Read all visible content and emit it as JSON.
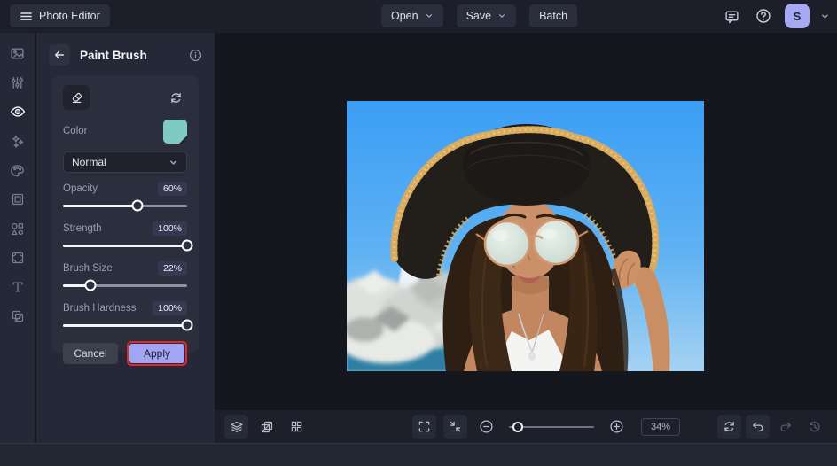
{
  "topbar": {
    "app_title": "Photo Editor",
    "open_label": "Open",
    "save_label": "Save",
    "batch_label": "Batch",
    "avatar_initial": "S",
    "avatar_color": "#a6a8f2",
    "icons": [
      "menu-icon",
      "chat-icon",
      "help-icon",
      "chevron-down-icon"
    ]
  },
  "sidebar": {
    "active_item": "eye-tool",
    "items": [
      "image-manager-icon",
      "adjustments-icon",
      "eye-icon",
      "effects-icon",
      "artsy-icon",
      "frame-icon",
      "graphics-icon",
      "ornate-frame-icon",
      "text-icon",
      "overlays-icon"
    ]
  },
  "panel": {
    "title": "Paint Brush",
    "header_icons": [
      "back-arrow-icon",
      "info-icon"
    ],
    "tool_icons": [
      "eraser-icon",
      "reset-icon"
    ],
    "color_label": "Color",
    "color_value": "#7fcbc3",
    "blend_mode": "Normal",
    "sliders": [
      {
        "label": "Opacity",
        "value": "60%",
        "percent": 60
      },
      {
        "label": "Strength",
        "value": "100%",
        "percent": 100
      },
      {
        "label": "Brush Size",
        "value": "22%",
        "percent": 22
      },
      {
        "label": "Brush Hardness",
        "value": "100%",
        "percent": 100
      }
    ],
    "cancel_label": "Cancel",
    "apply_label": "Apply",
    "apply_highlight_color": "#e8252a"
  },
  "canvas": {
    "photo_alt": "Young woman in a black floppy sun hat with frayed tan trim and mirrored round sunglasses, touching the brim; blue sky, white breakwater rocks, lighthouse and sea behind her"
  },
  "toolbar": {
    "zoom_level": "34%",
    "zoom_slider_percent": 10,
    "icons": [
      "layers-icon",
      "compare-icon",
      "grid-icon",
      "fullscreen-icon",
      "fit-screen-icon",
      "zoom-out-icon",
      "zoom-in-icon",
      "reset-icon",
      "undo-icon",
      "redo-icon",
      "history-icon"
    ]
  }
}
